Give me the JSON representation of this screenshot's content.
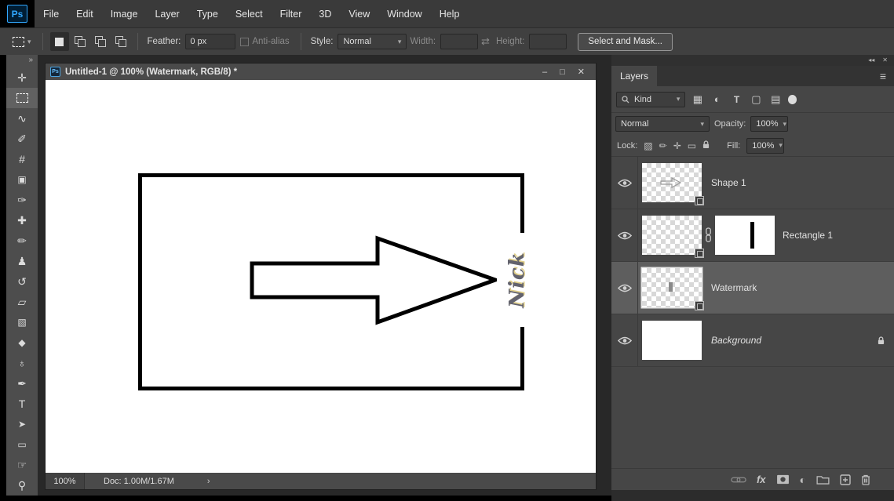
{
  "app": {
    "logo_text": "Ps"
  },
  "ui": {
    "caret": "▾"
  },
  "menubar": {
    "items": [
      "File",
      "Edit",
      "Image",
      "Layer",
      "Type",
      "Select",
      "Filter",
      "3D",
      "View",
      "Window",
      "Help"
    ]
  },
  "options_bar": {
    "feather_label": "Feather:",
    "feather_value": "0 px",
    "antialias_label": "Anti-alias",
    "style_label": "Style:",
    "style_value": "Normal",
    "width_label": "Width:",
    "swap_glyph": "⇄",
    "height_label": "Height:",
    "select_and_mask_label": "Select and Mask..."
  },
  "toolbar": {
    "collapse_glyph": "»",
    "tools": [
      {
        "name": "move-tool",
        "glyph": "✛"
      },
      {
        "name": "rectangular-marquee-tool",
        "glyph": "",
        "selected": true
      },
      {
        "name": "lasso-tool",
        "glyph": "∿"
      },
      {
        "name": "quick-selection-tool",
        "glyph": "✐"
      },
      {
        "name": "crop-tool",
        "glyph": "#"
      },
      {
        "name": "frame-tool",
        "glyph": "▣"
      },
      {
        "name": "eyedropper-tool",
        "glyph": "✑"
      },
      {
        "name": "spot-healing-brush-tool",
        "glyph": "✚"
      },
      {
        "name": "brush-tool",
        "glyph": "✏"
      },
      {
        "name": "clone-stamp-tool",
        "glyph": "♟"
      },
      {
        "name": "history-brush-tool",
        "glyph": "↺"
      },
      {
        "name": "eraser-tool",
        "glyph": "▱"
      },
      {
        "name": "gradient-tool",
        "glyph": "▧"
      },
      {
        "name": "blur-tool",
        "glyph": "◆"
      },
      {
        "name": "dodge-tool",
        "glyph": "♁"
      },
      {
        "name": "pen-tool",
        "glyph": "✒"
      },
      {
        "name": "horizontal-type-tool",
        "glyph": "T"
      },
      {
        "name": "path-selection-tool",
        "glyph": "➤"
      },
      {
        "name": "rectangle-tool",
        "glyph": "▭"
      },
      {
        "name": "hand-tool",
        "glyph": "☞"
      },
      {
        "name": "zoom-tool",
        "glyph": "⚲"
      }
    ]
  },
  "document_window": {
    "title": "Untitled-1 @ 100% (Watermark, RGB/8) *",
    "buttons": {
      "minimize": "–",
      "maximize": "□",
      "close": "✕"
    },
    "status": {
      "zoom": "100%",
      "doc_info": "Doc: 1.00M/1.67M",
      "chevron": "›"
    },
    "canvas": {
      "watermark_text": "Nick"
    }
  },
  "layers_panel": {
    "collapse_glyph": "◂◂",
    "close_glyph": "✕",
    "tab_label": "Layers",
    "menu_glyph": "≡",
    "filter_row": {
      "kind_label": "Kind",
      "pixel_glyph": "▦",
      "adjustment_glyph": "◐",
      "type_glyph": "T",
      "shape_glyph": "▢",
      "smart_glyph": "▤"
    },
    "blend_row": {
      "mode": "Normal",
      "opacity_label": "Opacity:",
      "opacity_value": "100%"
    },
    "lock_row": {
      "label": "Lock:",
      "transparent_glyph": "▨",
      "paint_glyph": "✏",
      "move_glyph": "✛",
      "artboard_glyph": "▭",
      "fill_label": "Fill:",
      "fill_value": "100%"
    },
    "layers": [
      {
        "name": "Shape 1"
      },
      {
        "name": "Rectangle 1"
      },
      {
        "name": "Watermark",
        "selected": true
      },
      {
        "name": "Background",
        "locked": true
      }
    ],
    "bottom_bar": {
      "fx_label": "fx",
      "adjustment_glyph": "◐"
    }
  }
}
